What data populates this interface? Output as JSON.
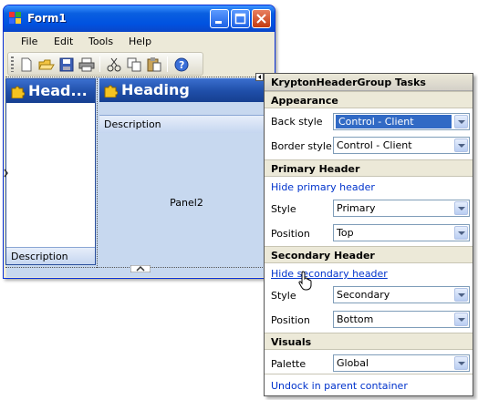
{
  "form": {
    "title": "Form1",
    "menu": [
      "File",
      "Edit",
      "Tools",
      "Help"
    ],
    "toolbar_icons": [
      "new-icon",
      "open-icon",
      "save-icon",
      "print-icon",
      "cut-icon",
      "copy-icon",
      "paste-icon",
      "help-icon"
    ]
  },
  "designer": {
    "left_heading": "Head...",
    "left_description": "Description",
    "right_heading": "Heading",
    "right_description": "Description",
    "panel2_label": "Panel2"
  },
  "tasks": {
    "title": "KryptonHeaderGroup Tasks",
    "appearance": {
      "header": "Appearance",
      "back_style_label": "Back style",
      "back_style_value": "Control - Client",
      "border_style_label": "Border style",
      "border_style_value": "Control - Client"
    },
    "primary": {
      "header": "Primary Header",
      "hide_link": "Hide primary header",
      "style_label": "Style",
      "style_value": "Primary",
      "position_label": "Position",
      "position_value": "Top"
    },
    "secondary": {
      "header": "Secondary Header",
      "hide_link": "Hide secondary header",
      "style_label": "Style",
      "style_value": "Secondary",
      "position_label": "Position",
      "position_value": "Bottom"
    },
    "visuals": {
      "header": "Visuals",
      "palette_label": "Palette",
      "palette_value": "Global"
    },
    "undock_link": "Undock in parent container"
  },
  "colors": {
    "link": "#0033cc",
    "selection": "#316ac5",
    "header_blue": "#1f4ea8",
    "panel_bg": "#c7d8ef"
  }
}
